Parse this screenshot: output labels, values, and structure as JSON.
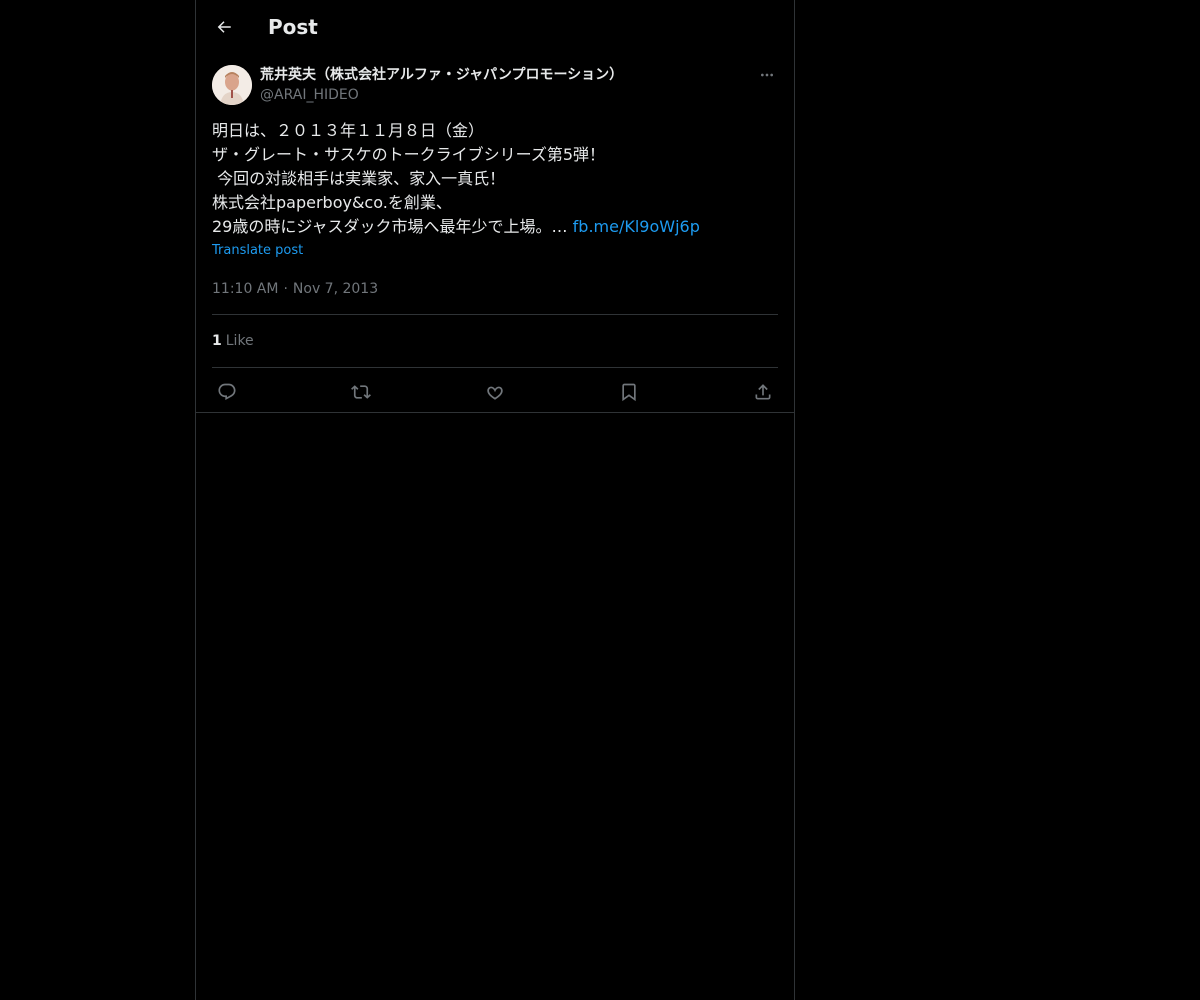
{
  "header": {
    "title": "Post",
    "back_icon": "arrow-left-icon"
  },
  "author": {
    "name": "荒井英夫（株式会社アルファ・ジャパンプロモーション）",
    "handle": "@ARAI_HIDEO",
    "more_icon": "more-horizontal-icon"
  },
  "post": {
    "lines": [
      "明日は、２０１３年１１月８日（金）",
      "ザ・グレート・サスケのトークライブシリーズ第5弾！",
      " 今回の対談相手は実業家、家入一真氏！",
      "株式会社paperboy&co.を創業、",
      "29歳の時にジャスダック市場へ最年少で上場。… "
    ],
    "link": "fb.me/Kl9oWj6p",
    "translate_label": "Translate post"
  },
  "meta": {
    "time": "11:10 AM",
    "separator": "·",
    "date": "Nov 7, 2013"
  },
  "stats": {
    "like_count": "1",
    "like_label": "Like"
  },
  "actions": [
    {
      "name": "reply-icon"
    },
    {
      "name": "repost-icon"
    },
    {
      "name": "like-icon"
    },
    {
      "name": "bookmark-icon"
    },
    {
      "name": "share-icon"
    }
  ],
  "colors": {
    "background": "#000000",
    "text": "#e7e9ea",
    "secondary": "#71767b",
    "accent": "#1d9bf0",
    "border": "#2f3336"
  }
}
